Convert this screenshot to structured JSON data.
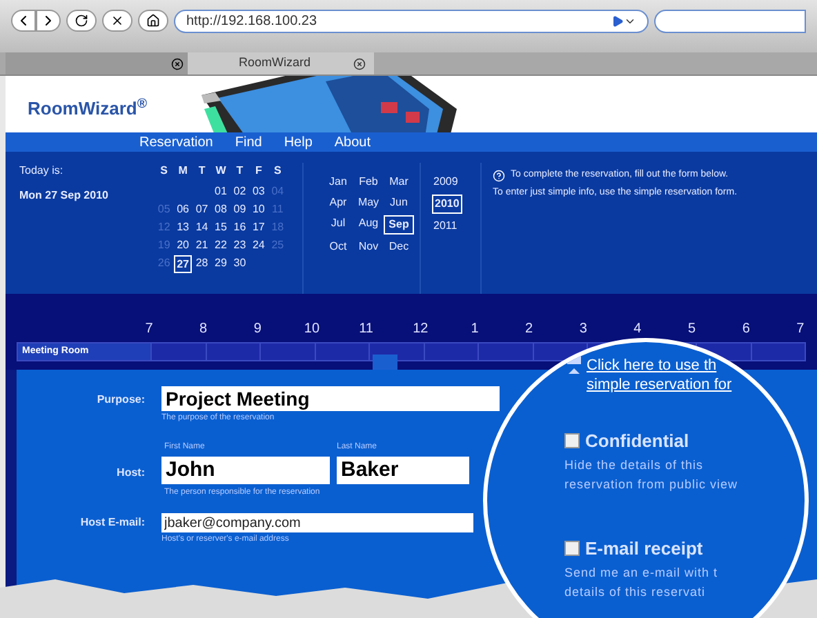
{
  "browser": {
    "url": "http://192.168.100.23",
    "tab_title": "RoomWizard"
  },
  "header": {
    "logo": "RoomWizard$^{®}$"
  },
  "nav": [
    "Reservation",
    "Find",
    "Help",
    "About"
  ],
  "today": {
    "label": "Today is:",
    "date": "Mon 27 Sep 2010"
  },
  "calendar": {
    "weekdays": [
      "S",
      "M",
      "T",
      "W",
      "T",
      "F",
      "S"
    ],
    "weeks": [
      [
        {
          "label": "01",
          "weekend": false,
          "selected": false
        },
        {
          "label": "02",
          "weekend": false,
          "selected": false
        },
        {
          "label": "03",
          "weekend": false,
          "selected": false
        },
        {
          "label": "04",
          "weekend": true,
          "selected": false
        }
      ],
      [
        {
          "label": "05",
          "weekend": true,
          "selected": false
        },
        {
          "label": "06",
          "weekend": false,
          "selected": false
        },
        {
          "label": "07",
          "weekend": false,
          "selected": false
        },
        {
          "label": "08",
          "weekend": false,
          "selected": false
        },
        {
          "label": "09",
          "weekend": false,
          "selected": false
        },
        {
          "label": "10",
          "weekend": false,
          "selected": false
        },
        {
          "label": "11",
          "weekend": true,
          "selected": false
        }
      ],
      [
        {
          "label": "12",
          "weekend": true,
          "selected": false
        },
        {
          "label": "13",
          "weekend": false,
          "selected": false
        },
        {
          "label": "14",
          "weekend": false,
          "selected": false
        },
        {
          "label": "15",
          "weekend": false,
          "selected": false
        },
        {
          "label": "16",
          "weekend": false,
          "selected": false
        },
        {
          "label": "17",
          "weekend": false,
          "selected": false
        },
        {
          "label": "18",
          "weekend": true,
          "selected": false
        }
      ],
      [
        {
          "label": "19",
          "weekend": true,
          "selected": false
        },
        {
          "label": "20",
          "weekend": false,
          "selected": false
        },
        {
          "label": "21",
          "weekend": false,
          "selected": false
        },
        {
          "label": "22",
          "weekend": false,
          "selected": false
        },
        {
          "label": "23",
          "weekend": false,
          "selected": false
        },
        {
          "label": "24",
          "weekend": false,
          "selected": false
        },
        {
          "label": "25",
          "weekend": true,
          "selected": false
        }
      ],
      [
        {
          "label": "26",
          "weekend": true,
          "selected": false
        },
        {
          "label": "27",
          "weekend": false,
          "selected": true
        },
        {
          "label": "28",
          "weekend": false,
          "selected": false
        },
        {
          "label": "29",
          "weekend": false,
          "selected": false
        },
        {
          "label": "30",
          "weekend": false,
          "selected": false
        }
      ]
    ],
    "months": [
      {
        "label": "Jan",
        "selected": false
      },
      {
        "label": "Feb",
        "selected": false
      },
      {
        "label": "Mar",
        "selected": false
      },
      {
        "label": "Apr",
        "selected": false
      },
      {
        "label": "May",
        "selected": false
      },
      {
        "label": "Jun",
        "selected": false
      },
      {
        "label": "Jul",
        "selected": false
      },
      {
        "label": "Aug",
        "selected": false
      },
      {
        "label": "Sep",
        "selected": true
      },
      {
        "label": "Oct",
        "selected": false
      },
      {
        "label": "Nov",
        "selected": false
      },
      {
        "label": "Dec",
        "selected": false
      }
    ],
    "years": [
      {
        "label": "2009",
        "selected": false
      },
      {
        "label": "2010",
        "selected": true
      },
      {
        "label": "2011",
        "selected": false
      }
    ]
  },
  "info": [
    "To complete the reservation, fill out the form below.",
    "To enter just simple info, use the simple reservation form."
  ],
  "timeline": {
    "hours": [
      "7",
      "8",
      "9",
      "10",
      "11",
      "12",
      "1",
      "2",
      "3",
      "4",
      "5",
      "6",
      "7"
    ],
    "room": "Meeting Room"
  },
  "form": {
    "purpose": {
      "label": "Purpose:",
      "value": "Project Meeting",
      "hint": "The purpose of the reservation"
    },
    "host": {
      "label": "Host:",
      "first_label": "First Name",
      "first_value": "John",
      "last_label": "Last Name",
      "last_value": "Baker",
      "hint": "The person responsible for the reservation"
    },
    "email": {
      "label": "Host E-mail:",
      "value": "jbaker@company.com",
      "hint": "Host's or reserver's e-mail address"
    }
  },
  "magnifier": {
    "link": [
      "Click here to use th",
      "simple reservation for"
    ],
    "options": [
      {
        "label": "Confidential",
        "checked": false,
        "description": [
          "Hide the details of this",
          "reservation from public view"
        ]
      },
      {
        "label": "E-mail receipt",
        "checked": false,
        "description": [
          "Send me an e-mail with t",
          "details of this reservati"
        ]
      }
    ]
  }
}
